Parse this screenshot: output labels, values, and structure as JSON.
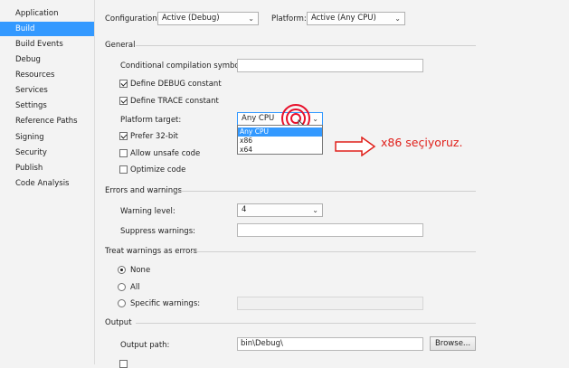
{
  "sidebar": {
    "items": [
      {
        "label": "Application"
      },
      {
        "label": "Build"
      },
      {
        "label": "Build Events"
      },
      {
        "label": "Debug"
      },
      {
        "label": "Resources"
      },
      {
        "label": "Services"
      },
      {
        "label": "Settings"
      },
      {
        "label": "Reference Paths"
      },
      {
        "label": "Signing"
      },
      {
        "label": "Security"
      },
      {
        "label": "Publish"
      },
      {
        "label": "Code Analysis"
      }
    ],
    "active_index": 1,
    "accent_color": "#3399ff"
  },
  "config": {
    "configuration_label": "Configuration:",
    "configuration_value": "Active (Debug)",
    "platform_label": "Platform:",
    "platform_value": "Active (Any CPU)"
  },
  "general": {
    "section_label": "General",
    "conditional_symbols_label": "Conditional compilation symbols:",
    "conditional_symbols_value": "",
    "define_debug_label": "Define DEBUG constant",
    "define_debug_checked": true,
    "define_trace_label": "Define TRACE constant",
    "define_trace_checked": true,
    "platform_target_label": "Platform target:",
    "platform_target_value": "Any CPU",
    "platform_target_options": [
      "Any CPU",
      "x86",
      "x64"
    ],
    "prefer32_label": "Prefer 32-bit",
    "prefer32_checked": true,
    "unsafe_label": "Allow unsafe code",
    "unsafe_checked": false,
    "optimize_label": "Optimize code",
    "optimize_checked": false
  },
  "errors": {
    "section_label": "Errors and warnings",
    "warning_level_label": "Warning level:",
    "warning_level_value": "4",
    "suppress_label": "Suppress warnings:",
    "suppress_value": ""
  },
  "treat_warnings": {
    "section_label": "Treat warnings as errors",
    "none_label": "None",
    "all_label": "All",
    "specific_label": "Specific warnings:",
    "selected": "None"
  },
  "output": {
    "section_label": "Output",
    "output_path_label": "Output path:",
    "output_path_value": "bin\\Debug\\",
    "browse_label": "Browse..."
  },
  "annotation": {
    "text": "x86 seçiyoruz.",
    "color": "#e0201b"
  }
}
